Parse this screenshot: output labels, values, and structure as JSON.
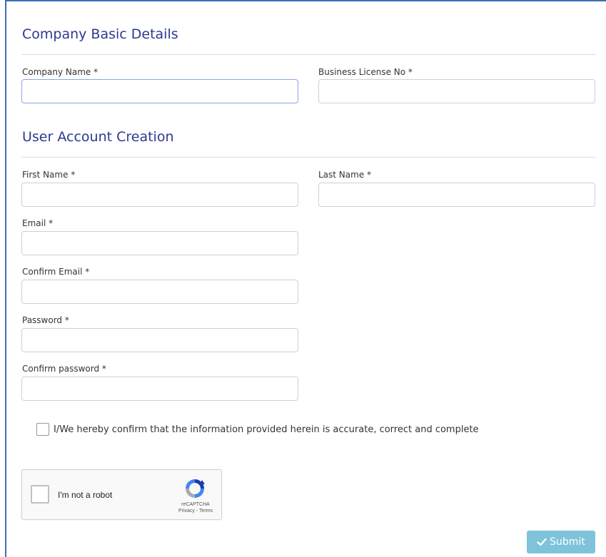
{
  "company_section": {
    "title": "Company Basic Details",
    "company_name": {
      "label": "Company Name *",
      "value": "",
      "placeholder": ""
    },
    "business_license": {
      "label": "Business License No *",
      "value": "",
      "placeholder": ""
    }
  },
  "account_section": {
    "title": "User Account Creation",
    "first_name": {
      "label": "First Name *",
      "value": "",
      "placeholder": ""
    },
    "last_name": {
      "label": "Last Name *",
      "value": "",
      "placeholder": ""
    },
    "email": {
      "label": "Email *",
      "value": "",
      "placeholder": ""
    },
    "confirm_email": {
      "label": "Confirm Email *",
      "value": "",
      "placeholder": ""
    },
    "password": {
      "label": "Password *",
      "value": "",
      "placeholder": ""
    },
    "confirm_password": {
      "label": "Confirm password *",
      "value": "",
      "placeholder": ""
    }
  },
  "consent": {
    "checked": false,
    "text": "I/We hereby confirm that the information provided herein is accurate, correct and complete"
  },
  "recaptcha": {
    "label": "I'm not a robot",
    "brand": "reCAPTCHA",
    "links": "Privacy - Terms",
    "icon": "recaptcha-logo"
  },
  "submit": {
    "label": "Submit",
    "icon": "check-icon",
    "color": "#7fc3db"
  },
  "colors": {
    "heading": "#2c3a8f",
    "border_accent": "#3a6fb4",
    "focus_border": "#8aa6e6"
  }
}
